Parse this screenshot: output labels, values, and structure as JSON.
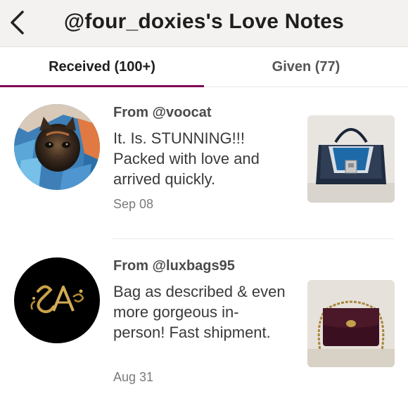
{
  "header": {
    "title": "@four_doxies's Love Notes",
    "back_icon": "chevron-left-icon"
  },
  "tabs": [
    {
      "label": "Received (100+)",
      "active": true
    },
    {
      "label": "Given (77)",
      "active": false
    }
  ],
  "colors": {
    "accent": "#7f0353",
    "header_bg": "#f4f2f0"
  },
  "notes": [
    {
      "from": "From @voocat",
      "message": "It. Is. STUNNING!!! Packed with love and arrived quickly.",
      "date": "Sep 08",
      "avatar": "cat-avatar",
      "thumbnail": "blue-handbag-image"
    },
    {
      "from": "From @luxbags95",
      "message": "Bag as described & even more gorgeous in-person! Fast shipment.",
      "date": "Aug 31",
      "avatar": "sa-monogram-avatar",
      "thumbnail": "burgundy-chain-bag-image"
    }
  ]
}
